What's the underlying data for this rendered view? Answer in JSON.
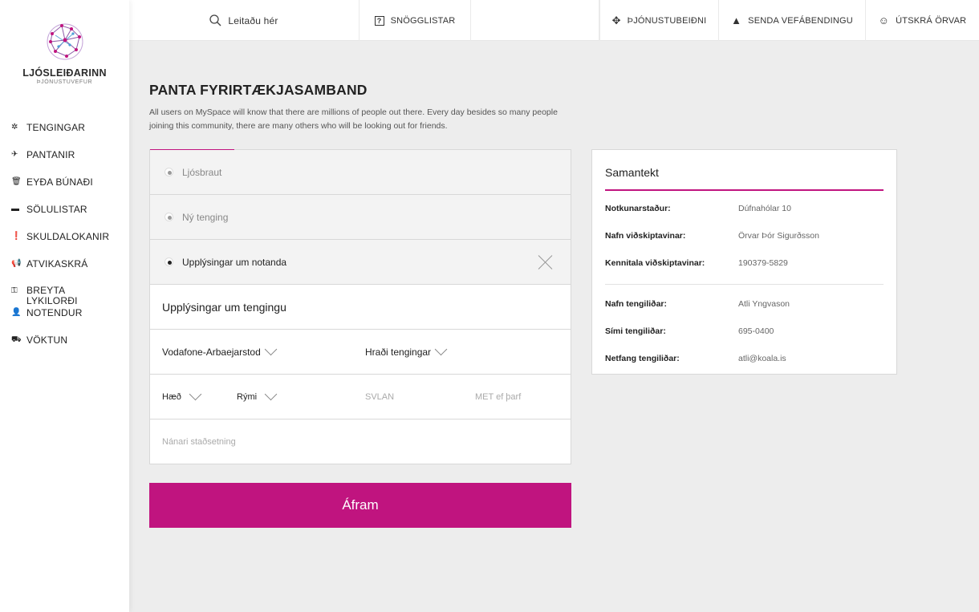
{
  "brand": {
    "name": "LJÓSLEIÐARINN",
    "subtitle": "ÞJÓNUSTUVEFUR",
    "accent": "#c0147f"
  },
  "sidebar": {
    "items": [
      {
        "label": "TENGINGAR",
        "icon": "sparkle-icon"
      },
      {
        "label": "PANTANIR",
        "icon": "plane-icon"
      },
      {
        "label": "EYÐA BÚNAÐI",
        "icon": "trash-icon"
      },
      {
        "label": "SÖLULISTAR",
        "icon": "briefcase-icon"
      },
      {
        "label": "SKULDALOKANIR",
        "icon": "alert-circle-icon"
      },
      {
        "label": "ATVIKASKRÁ",
        "icon": "megaphone-icon"
      },
      {
        "label": "BREYTA LYKILORÐI",
        "icon": "key-icon"
      },
      {
        "label": "NOTENDUR",
        "icon": "user-icon"
      },
      {
        "label": "VÖKTUN",
        "icon": "binoculars-icon"
      }
    ]
  },
  "topbar": {
    "search_placeholder": "Leitaðu hér",
    "quicklists": "SNÖGGLISTAR",
    "service_request": "ÞJÓNUSTUBEIÐNI",
    "send_feedback": "SENDA VEFÁBENDINGU",
    "logout": "ÚTSKRÁ ÖRVAR"
  },
  "main": {
    "title": "PANTA FYRIRTÆKJASAMBAND",
    "description": "All users on MySpace will know that there are millions of people out there. Every day besides so many people joining this community, there are many others who will be looking out for friends."
  },
  "form": {
    "steps": [
      {
        "label": "Ljósbraut",
        "active": false
      },
      {
        "label": "Ný tenging",
        "active": false
      },
      {
        "label": "Upplýsingar um notanda",
        "active": true
      }
    ],
    "section_title": "Upplýsingar um tengingu",
    "provider": "Vodafone-Arbaejarstod",
    "speed": "Hraði tengingar",
    "floor": "Hæð",
    "room": "Rými",
    "svlan_placeholder": "SVLAN",
    "met_placeholder": "MET ef þarf",
    "location_placeholder": "Nánari staðsetning",
    "continue": "Áfram"
  },
  "summary": {
    "title": "Samantekt",
    "usage_location_label": "Notkunarstaður:",
    "usage_location": "Dúfnahólar 10",
    "customer_name_label": "Nafn viðskiptavinar:",
    "customer_name": "Örvar Þór Sigurðsson",
    "customer_id_label": "Kennitala viðskiptavinar:",
    "customer_id": "190379-5829",
    "contact_name_label": "Nafn tengiliðar:",
    "contact_name": "Atli Yngvason",
    "contact_phone_label": "Sími tengiliðar:",
    "contact_phone": "695-0400",
    "contact_email_label": "Netfang tengiliðar:",
    "contact_email": "atli@koala.is"
  }
}
